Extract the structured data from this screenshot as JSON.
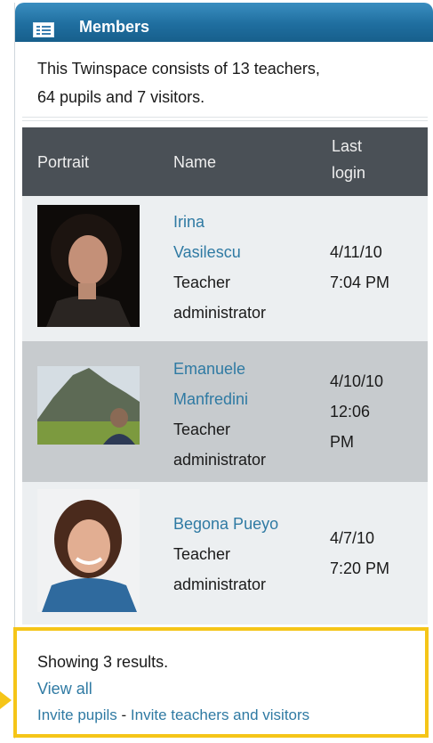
{
  "header": {
    "title": "Members",
    "icon": "members-list-icon"
  },
  "summary": {
    "line1": "This Twinspace consists of 13 teachers,",
    "line2": "64 pupils and 7 visitors."
  },
  "table": {
    "columns": {
      "portrait": "Portrait",
      "name": "Name",
      "last_login_1": "Last",
      "last_login_2": "login"
    },
    "rows": [
      {
        "name_1": "Irina",
        "name_2": "Vasilescu",
        "role_1": "Teacher",
        "role_2": "administrator",
        "date": "4/11/10",
        "time": "7:04 PM"
      },
      {
        "name_1": "Emanuele",
        "name_2": "Manfredini",
        "role_1": "Teacher",
        "role_2": "administrator",
        "date": "4/10/10",
        "time_1": "12:06",
        "time_2": "PM"
      },
      {
        "name_1": "Begona Pueyo",
        "role_1": "Teacher",
        "role_2": "administrator",
        "date": "4/7/10",
        "time": "7:20 PM"
      }
    ]
  },
  "footer": {
    "results": "Showing 3 results.",
    "view_all": "View all",
    "invite_pupils": "Invite pupils",
    "separator": " - ",
    "invite_teachers": "Invite teachers and visitors"
  },
  "colors": {
    "header": "#1f6e9f",
    "link": "#2f7aa3",
    "table_header": "#4a5056",
    "row_alt": "#c7cbce",
    "row": "#eceff1",
    "highlight": "#f5c518"
  }
}
